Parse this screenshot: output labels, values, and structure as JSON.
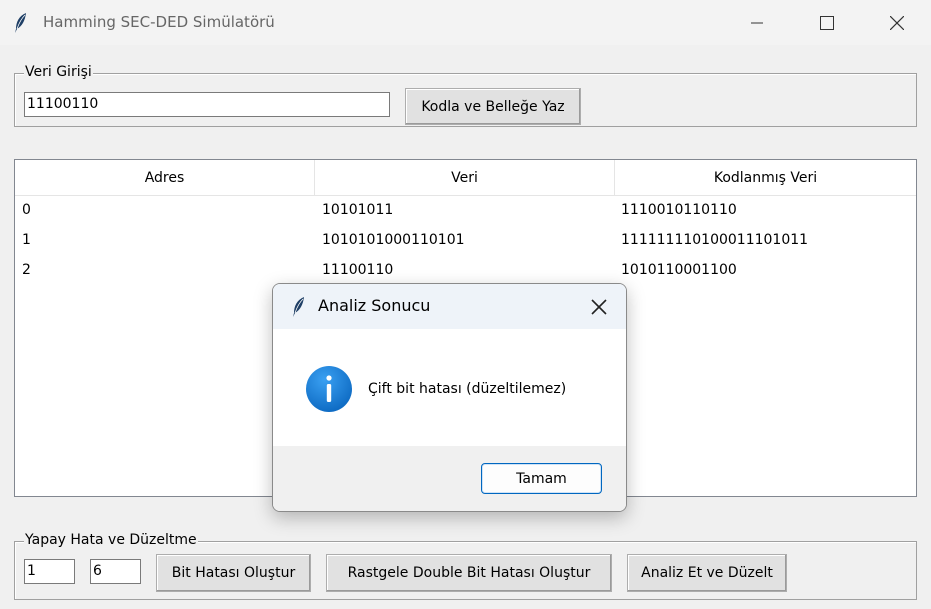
{
  "window": {
    "title": "Hamming SEC-DED Simülatörü"
  },
  "input_group": {
    "label": "Veri Girişi",
    "input_value": "11100110",
    "encode_button": "Kodla ve Belleğe Yaz"
  },
  "table": {
    "columns": [
      "Adres",
      "Veri",
      "Kodlanmış Veri"
    ],
    "rows": [
      [
        "0",
        "10101011",
        "1110010110110"
      ],
      [
        "1",
        "1010101000110101",
        "111111110100011101011"
      ],
      [
        "2",
        "11100110",
        "1010110001100"
      ]
    ]
  },
  "error_group": {
    "label": "Yapay Hata ve Düzeltme",
    "address_value": "1",
    "bit_value": "6",
    "bit_error_button": "Bit Hatası Oluştur",
    "double_error_button": "Rastgele Double Bit Hatası Oluştur",
    "analyze_button": "Analiz Et ve Düzelt"
  },
  "dialog": {
    "title": "Analiz Sonucu",
    "icon": "info-icon",
    "message": "Çift bit hatası (düzeltilemez)",
    "ok_button": "Tamam"
  },
  "colors": {
    "accent": "#0067c0",
    "info_icon": "#1a7fd8"
  }
}
